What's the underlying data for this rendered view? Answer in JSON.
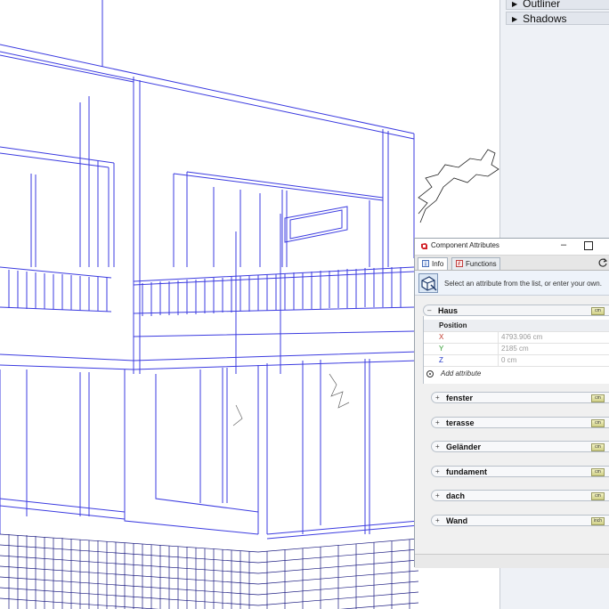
{
  "tray": {
    "items": [
      {
        "label": "Outliner"
      },
      {
        "label": "Shadows"
      }
    ]
  },
  "component_attributes": {
    "title": "Component Attributes",
    "controls": {
      "minimize": "–"
    },
    "tabs": [
      {
        "label": "Info",
        "selected": true
      },
      {
        "label": "Functions",
        "selected": false
      }
    ],
    "hint": "Select an attribute from the list, or enter your own.",
    "expanded_component": {
      "name": "Haus",
      "expander": "–",
      "unit_badge": "cm",
      "group_label": "Position",
      "attributes": [
        {
          "key": "X",
          "value": "4793.906 cm",
          "color": "#c0392b"
        },
        {
          "key": "Y",
          "value": "2185 cm",
          "color": "#2e9a2e"
        },
        {
          "key": "Z",
          "value": "0 cm",
          "color": "#2035c8"
        }
      ],
      "add_attribute_label": "Add attribute"
    },
    "collapsed_components": [
      {
        "name": "fenster",
        "unit_badge": "cm",
        "expander": "+"
      },
      {
        "name": "terasse",
        "unit_badge": "cm",
        "expander": "+"
      },
      {
        "name": "Geländer",
        "unit_badge": "cm",
        "expander": "+"
      },
      {
        "name": "fundament",
        "unit_badge": "cm",
        "expander": "+"
      },
      {
        "name": "dach",
        "unit_badge": "cm",
        "expander": "+"
      },
      {
        "name": "Wand",
        "unit_badge": "inch",
        "expander": "+"
      }
    ]
  },
  "colors": {
    "wire": "#3b3be0",
    "wire_dark": "#1a1a80",
    "tray_bg": "#eef1f6"
  }
}
